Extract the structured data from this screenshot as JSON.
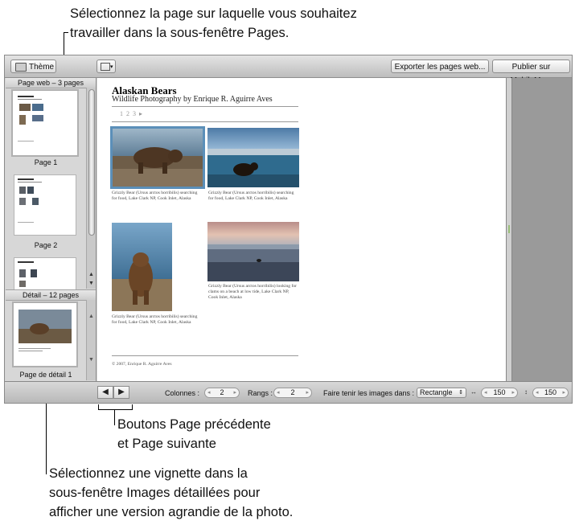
{
  "callouts": {
    "top_line1": "Sélectionnez la page sur laquelle vous souhaitez",
    "top_line2": "travailler dans la sous-fenêtre Pages.",
    "mid_line1": "Boutons Page précédente",
    "mid_line2": "et Page suivante",
    "bottom_line1": "Sélectionnez une vignette dans la",
    "bottom_line2": "sous-fenêtre Images détaillées pour",
    "bottom_line3": "afficher une version agrandie de la photo."
  },
  "toolbar": {
    "theme_label": "Thème",
    "export_label": "Exporter les pages web...",
    "publish_label": "Publier sur MobileMe..."
  },
  "sidebar": {
    "pages_header": "Page web – 3 pages",
    "pages": [
      {
        "label": "Page 1"
      },
      {
        "label": "Page 2"
      }
    ],
    "detail_header": "Détail – 12 pages",
    "detail_label": "Page de détail 1"
  },
  "webpage": {
    "title": "Alaskan Bears",
    "subtitle": "Wildlife Photography by Enrique R. Aguirre Aves",
    "page_nav": "1 2 3 ▸",
    "captions": [
      "Grizzly Bear (Ursus arctos horribilis) searching for food, Lake Clark NP, Cook Inlet, Alaska",
      "Grizzly Bear (Ursus arctos horribilis) searching for food, Lake Clark NP, Cook Inlet, Alaska",
      "Grizzly Bear (Ursus arctos horribilis) looking for clams on a beach at low tide, Lake Clark NP, Cook Inlet, Alaska",
      "Grizzly Bear (Ursus arctos horribilis) searching for food, Lake Clark NP, Cook Inlet, Alaska"
    ],
    "footer": "© 2007, Enrique R. Aguirre Aves"
  },
  "bottombar": {
    "prev_glyph": "◀",
    "next_glyph": "▶",
    "columns_label": "Colonnes :",
    "columns_value": "2",
    "rows_label": "Rangs :",
    "rows_value": "2",
    "fit_label": "Faire tenir les images dans :",
    "fit_value": "Rectangle",
    "width_value": "150",
    "height_value": "150"
  },
  "colors": {
    "window_bg": "#d4d4d4",
    "selection": "#5b8fb9"
  }
}
